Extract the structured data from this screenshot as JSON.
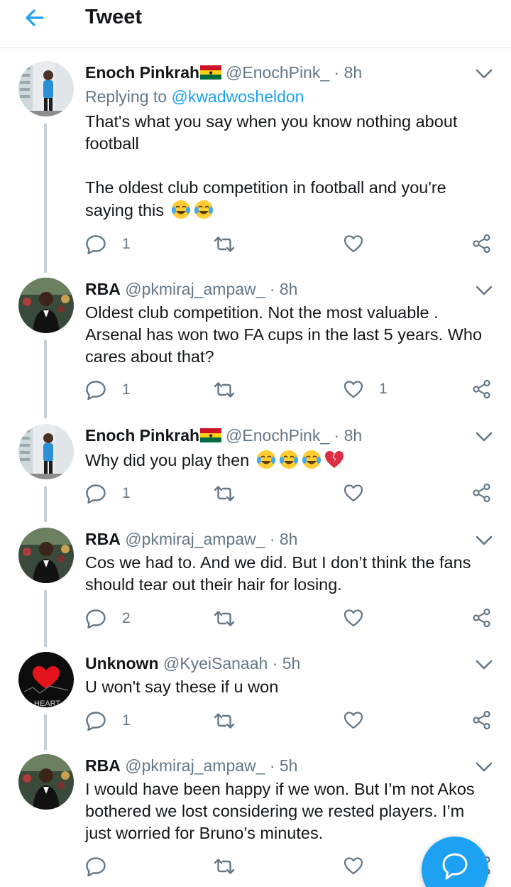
{
  "header": {
    "title": "Tweet",
    "back_icon": "arrow-left-icon"
  },
  "colors": {
    "accent": "#1da1f2",
    "muted": "#657786",
    "text": "#14171a",
    "thread_line": "#c4cfd6"
  },
  "tweets": [
    {
      "name": "Enoch Pinkrah",
      "has_flag": true,
      "handle": "@EnochPink_",
      "dot": "·",
      "time": "8h",
      "reply_prefix": "Replying to",
      "reply_mention": "@kwadwosheldon",
      "lines": [
        "That's what you say when you know nothing about",
        "football",
        "",
        "The oldest club competition in football and you're",
        "saying this"
      ],
      "emoji_suffix": [
        "tears-of-joy",
        "tears-of-joy"
      ],
      "reply_count": "1",
      "retweet_count": "",
      "like_count": ""
    },
    {
      "name": "RBA",
      "has_flag": false,
      "handle": "@pkmiraj_ampaw_",
      "dot": "·",
      "time": "8h",
      "lines": [
        "Oldest club competition. Not the most valuable .",
        "Arsenal has won two FA cups in the last 5 years. Who",
        "cares about that?"
      ],
      "reply_count": "1",
      "retweet_count": "",
      "like_count": "1"
    },
    {
      "name": "Enoch Pinkrah",
      "has_flag": true,
      "handle": "@EnochPink_",
      "dot": "·",
      "time": "8h",
      "lines": [
        "Why did you play then"
      ],
      "emoji_suffix": [
        "tears-of-joy",
        "tears-of-joy",
        "tears-of-joy",
        "broken-heart"
      ],
      "reply_count": "1",
      "retweet_count": "",
      "like_count": ""
    },
    {
      "name": "RBA",
      "has_flag": false,
      "handle": "@pkmiraj_ampaw_",
      "dot": "·",
      "time": "8h",
      "lines": [
        "Cos we had to. And we did. But I don’t think the fans",
        "should tear out their hair for losing."
      ],
      "reply_count": "2",
      "retweet_count": "",
      "like_count": ""
    },
    {
      "name": "Unknown",
      "has_flag": false,
      "handle": "@KyeiSanaah",
      "dot": "·",
      "time": "5h",
      "lines": [
        "U won't say these if u won"
      ],
      "avatar_text": "HEART",
      "reply_count": "1",
      "retweet_count": "",
      "like_count": ""
    },
    {
      "name": "RBA",
      "has_flag": false,
      "handle": "@pkmiraj_ampaw_",
      "dot": "·",
      "time": "5h",
      "lines": [
        "I would have been happy if we won. But I’m not Akos",
        "bothered we lost considering we rested players. I’m",
        "just worried for Bruno’s minutes."
      ],
      "reply_count": "",
      "retweet_count": "",
      "like_count": ""
    }
  ],
  "fab": {
    "icon": "compose-reply-icon"
  }
}
